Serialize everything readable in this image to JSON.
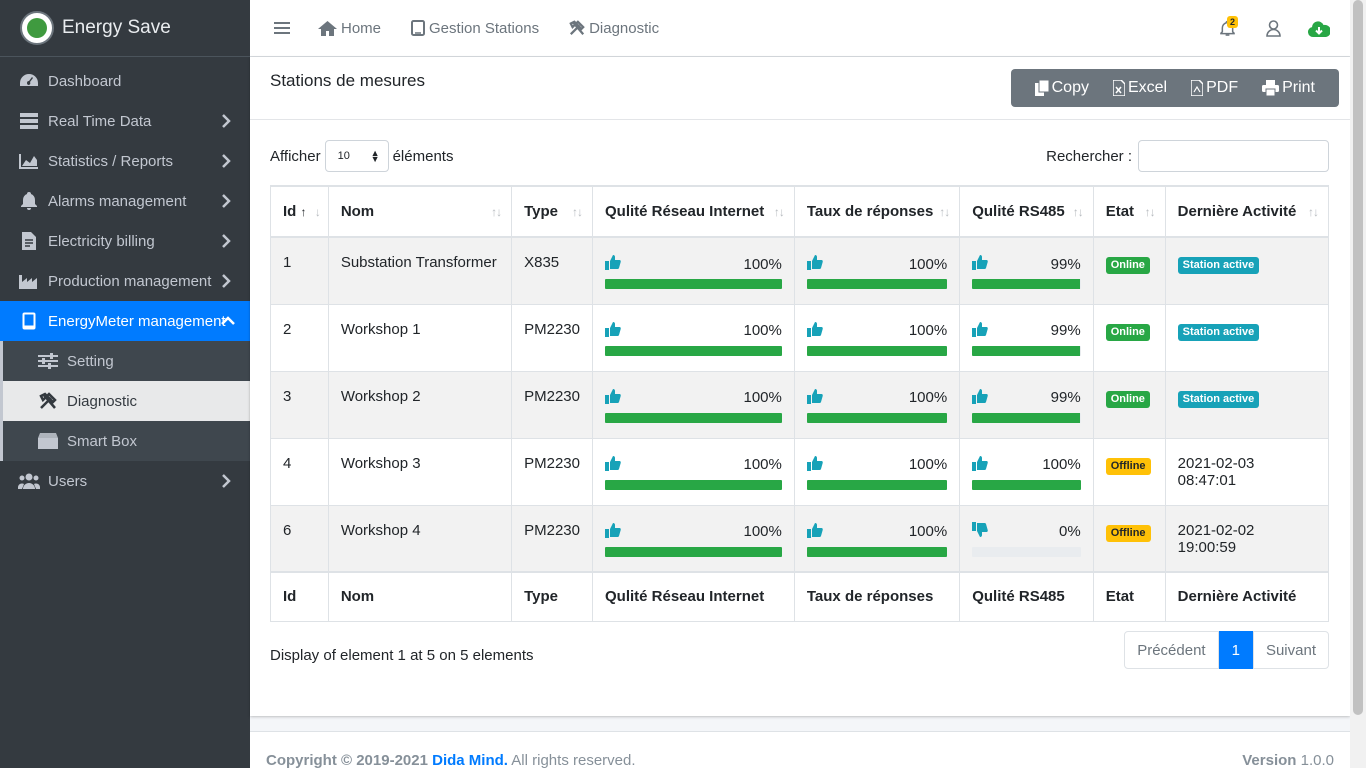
{
  "brand": {
    "name": "Energy Save"
  },
  "sidebar": {
    "items": [
      {
        "label": "Dashboard",
        "icon": "tachometer-icon"
      },
      {
        "label": "Real Time Data",
        "icon": "server-icon"
      },
      {
        "label": "Statistics / Reports",
        "icon": "area-chart-icon"
      },
      {
        "label": "Alarms management",
        "icon": "bell-icon"
      },
      {
        "label": "Electricity billing",
        "icon": "invoice-icon"
      },
      {
        "label": "Production management",
        "icon": "industry-icon"
      },
      {
        "label": "EnergyMeter management",
        "icon": "tablet-icon"
      },
      {
        "label": "Setting",
        "icon": "sliders-icon"
      },
      {
        "label": "Diagnostic",
        "icon": "tools-icon"
      },
      {
        "label": "Smart Box",
        "icon": "box-icon"
      },
      {
        "label": "Users",
        "icon": "users-icon"
      }
    ]
  },
  "topbar": {
    "home": "Home",
    "stations": "Gestion Stations",
    "diagnostic": "Diagnostic",
    "notif_count": "2"
  },
  "card": {
    "title": "Stations de mesures",
    "buttons": {
      "copy": "Copy",
      "excel": "Excel",
      "pdf": "PDF",
      "print": "Print"
    }
  },
  "controls": {
    "show_prefix": "Afficher",
    "page_size": "10",
    "show_suffix": "éléments",
    "search_label": "Rechercher :"
  },
  "table": {
    "headers": {
      "id": "Id",
      "nom": "Nom",
      "type": "Type",
      "reseau": "Qulité Réseau Internet",
      "taux": "Taux de réponses",
      "rs485": "Qulité RS485",
      "etat": "Etat",
      "activite": "Dernière Activité"
    },
    "rows": [
      {
        "id": "1",
        "nom": "Substation Transformer",
        "type": "X835",
        "reseau": "100%",
        "reseau_v": 100,
        "taux": "100%",
        "taux_v": 100,
        "rs485": "99%",
        "rs485_v": 99,
        "rs485_up": true,
        "etat": "Online",
        "etat_kind": "on",
        "activite": "Station active",
        "activite_badge": true
      },
      {
        "id": "2",
        "nom": "Workshop 1",
        "type": "PM2230",
        "reseau": "100%",
        "reseau_v": 100,
        "taux": "100%",
        "taux_v": 100,
        "rs485": "99%",
        "rs485_v": 99,
        "rs485_up": true,
        "etat": "Online",
        "etat_kind": "on",
        "activite": "Station active",
        "activite_badge": true
      },
      {
        "id": "3",
        "nom": "Workshop 2",
        "type": "PM2230",
        "reseau": "100%",
        "reseau_v": 100,
        "taux": "100%",
        "taux_v": 100,
        "rs485": "99%",
        "rs485_v": 99,
        "rs485_up": true,
        "etat": "Online",
        "etat_kind": "on",
        "activite": "Station active",
        "activite_badge": true
      },
      {
        "id": "4",
        "nom": "Workshop 3",
        "type": "PM2230",
        "reseau": "100%",
        "reseau_v": 100,
        "taux": "100%",
        "taux_v": 100,
        "rs485": "100%",
        "rs485_v": 100,
        "rs485_up": true,
        "etat": "Offline",
        "etat_kind": "off",
        "activite": "2021-02-03 08:47:01",
        "activite_badge": false
      },
      {
        "id": "6",
        "nom": "Workshop 4",
        "type": "PM2230",
        "reseau": "100%",
        "reseau_v": 100,
        "taux": "100%",
        "taux_v": 100,
        "rs485": "0%",
        "rs485_v": 0,
        "rs485_up": false,
        "etat": "Offline",
        "etat_kind": "off",
        "activite": "2021-02-02 19:00:59",
        "activite_badge": false
      }
    ]
  },
  "info": "Display of element 1 at 5 on 5 elements",
  "pager": {
    "prev": "Précédent",
    "page": "1",
    "next": "Suivant"
  },
  "footer": {
    "copyright": "Copyright © 2019-2021",
    "company": "Dida Mind.",
    "rights": "All rights reserved.",
    "version_label": "Version",
    "version": "1.0.0"
  },
  "colors": {
    "sidebar": "#343a40",
    "active": "#007bff",
    "success": "#28a745",
    "warning": "#ffc107",
    "info": "#17a2b8",
    "thumb": "#17a2b8"
  }
}
